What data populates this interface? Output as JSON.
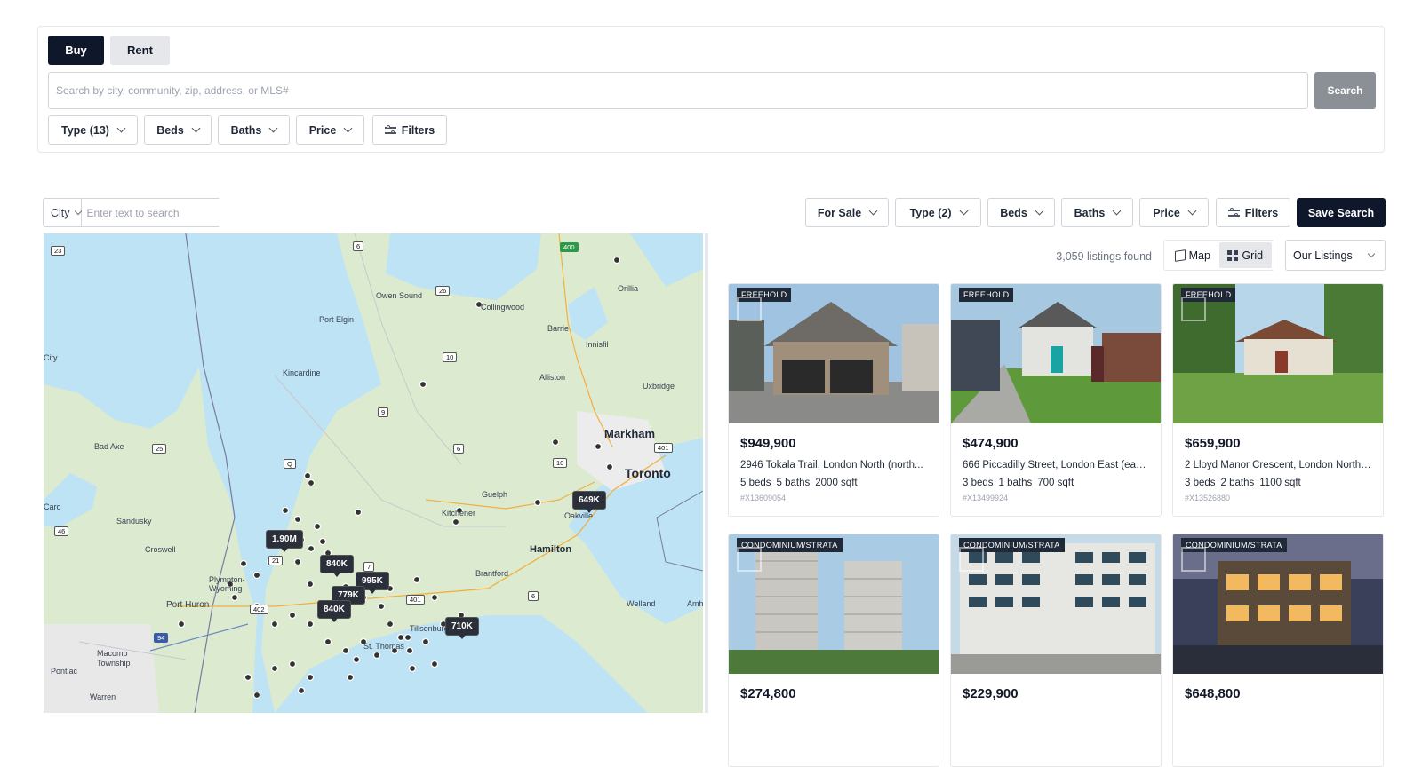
{
  "top_search": {
    "mode_buy": "Buy",
    "mode_rent": "Rent",
    "placeholder": "Search by city, community, zip, address, or MLS#",
    "search_button": "Search",
    "filters": [
      "Type (13)",
      "Beds",
      "Baths",
      "Price"
    ],
    "more_filters": "Filters"
  },
  "results_toolbar": {
    "city_select": "City",
    "city_placeholder": "Enter text to search",
    "filters": [
      "For Sale",
      "Type (2)",
      "Beds",
      "Baths",
      "Price"
    ],
    "more_filters": "Filters",
    "save_search": "Save Search",
    "listings_count": "3,059 listings found",
    "view_map": "Map",
    "view_grid": "Grid",
    "active_view": "Grid",
    "sort": "Our Listings"
  },
  "map": {
    "places": [
      "Owen Sound",
      "Collingwood",
      "Orillia",
      "Barrie",
      "Innisfil",
      "Port Elgin",
      "Kincardine",
      "Alliston",
      "Uxbridge",
      "Bad Axe",
      "Markham",
      "Toronto",
      "Guelph",
      "Kitchener",
      "Oakville",
      "Hamilton",
      "Brantford",
      "Caro",
      "Sandusky",
      "Croswell",
      "Plympton-Wyoming",
      "Port Huron",
      "Welland",
      "Macomb Township",
      "Pontiac",
      "Warren",
      "Tillsonburg",
      "St. Thomas",
      "City",
      "Amh"
    ],
    "highways": [
      "23",
      "6",
      "400",
      "26",
      "10",
      "9",
      "25",
      "6",
      "401",
      "10",
      "7",
      "21",
      "402",
      "401",
      "6",
      "46",
      "94",
      "Q"
    ],
    "price_pins": [
      "1.90M",
      "840K",
      "995K",
      "779K",
      "840K",
      "710K",
      "649K"
    ]
  },
  "listings": [
    {
      "badge": "FREEHOLD",
      "price": "$949,900",
      "address": "2946 Tokala Trail, London North (north...",
      "beds": "5 beds",
      "baths": "5 baths",
      "sqft": "2000 sqft",
      "mls": "#X13609054"
    },
    {
      "badge": "FREEHOLD",
      "price": "$474,900",
      "address": "666 Piccadilly Street, London East (east...",
      "beds": "3 beds",
      "baths": "1 baths",
      "sqft": "700 sqft",
      "mls": "#X13499924"
    },
    {
      "badge": "FREEHOLD",
      "price": "$659,900",
      "address": "2 Lloyd Manor Crescent, London North (...",
      "beds": "3 beds",
      "baths": "2 baths",
      "sqft": "1100 sqft",
      "mls": "#X13526880"
    },
    {
      "badge": "CONDOMINIUM/STRATA",
      "price": "$274,800"
    },
    {
      "badge": "CONDOMINIUM/STRATA",
      "price": "$229,900"
    },
    {
      "badge": "CONDOMINIUM/STRATA",
      "price": "$648,800"
    }
  ],
  "colors": {
    "primary": "#0f172a",
    "search_disabled": "#8b8f96",
    "water": "#bde3f5",
    "land": "#dcebd0"
  }
}
